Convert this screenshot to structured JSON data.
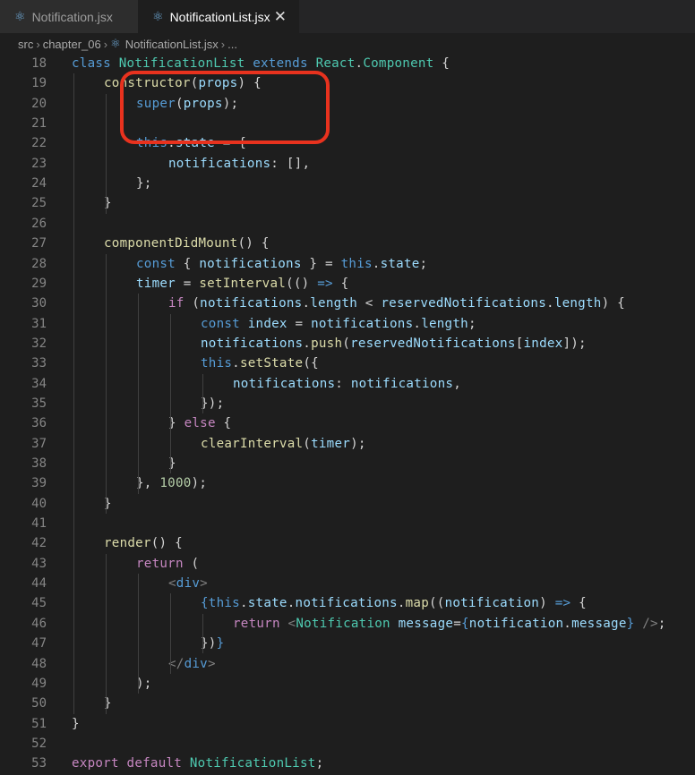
{
  "tabs": [
    {
      "label": "Notification.jsx",
      "active": false,
      "icon": "react-icon"
    },
    {
      "label": "NotificationList.jsx",
      "active": true,
      "icon": "react-icon"
    }
  ],
  "breadcrumb": {
    "items": [
      "src",
      "chapter_06",
      "NotificationList.jsx",
      "..."
    ]
  },
  "highlight": {
    "color": "#e8321e",
    "lines": [
      22,
      23,
      24
    ]
  },
  "code_lines": [
    {
      "n": 18,
      "indent": 0,
      "tokens": [
        [
          "kw",
          "class "
        ],
        [
          "cls",
          "NotificationList "
        ],
        [
          "kw",
          "extends "
        ],
        [
          "cls",
          "React"
        ],
        [
          "pun",
          "."
        ],
        [
          "cls",
          "Component"
        ],
        [
          "pun",
          " {"
        ]
      ]
    },
    {
      "n": 19,
      "indent": 1,
      "tokens": [
        [
          "fn",
          "constructor"
        ],
        [
          "pun",
          "("
        ],
        [
          "var",
          "props"
        ],
        [
          "pun",
          ") {"
        ]
      ]
    },
    {
      "n": 20,
      "indent": 2,
      "tokens": [
        [
          "kw",
          "super"
        ],
        [
          "pun",
          "("
        ],
        [
          "var",
          "props"
        ],
        [
          "pun",
          ");"
        ]
      ]
    },
    {
      "n": 21,
      "indent": 0,
      "tokens": []
    },
    {
      "n": 22,
      "indent": 2,
      "tokens": [
        [
          "kw",
          "this"
        ],
        [
          "pun",
          "."
        ],
        [
          "var",
          "state"
        ],
        [
          "pun",
          " = {"
        ]
      ]
    },
    {
      "n": 23,
      "indent": 3,
      "tokens": [
        [
          "var",
          "notifications"
        ],
        [
          "pun",
          ": [],"
        ]
      ]
    },
    {
      "n": 24,
      "indent": 2,
      "tokens": [
        [
          "pun",
          "};"
        ]
      ]
    },
    {
      "n": 25,
      "indent": 1,
      "tokens": [
        [
          "pun",
          "}"
        ]
      ]
    },
    {
      "n": 26,
      "indent": 0,
      "tokens": []
    },
    {
      "n": 27,
      "indent": 1,
      "tokens": [
        [
          "fn",
          "componentDidMount"
        ],
        [
          "pun",
          "() {"
        ]
      ]
    },
    {
      "n": 28,
      "indent": 2,
      "tokens": [
        [
          "kw",
          "const "
        ],
        [
          "pun",
          "{ "
        ],
        [
          "var",
          "notifications"
        ],
        [
          "pun",
          " } = "
        ],
        [
          "kw",
          "this"
        ],
        [
          "pun",
          "."
        ],
        [
          "var",
          "state"
        ],
        [
          "pun",
          ";"
        ]
      ]
    },
    {
      "n": 29,
      "indent": 2,
      "tokens": [
        [
          "var",
          "timer"
        ],
        [
          "pun",
          " = "
        ],
        [
          "fn",
          "setInterval"
        ],
        [
          "pun",
          "(() "
        ],
        [
          "kw",
          "=>"
        ],
        [
          "pun",
          " {"
        ]
      ]
    },
    {
      "n": 30,
      "indent": 3,
      "tokens": [
        [
          "ctrl",
          "if "
        ],
        [
          "pun",
          "("
        ],
        [
          "var",
          "notifications"
        ],
        [
          "pun",
          "."
        ],
        [
          "var",
          "length"
        ],
        [
          "pun",
          " < "
        ],
        [
          "var",
          "reservedNotifications"
        ],
        [
          "pun",
          "."
        ],
        [
          "var",
          "length"
        ],
        [
          "pun",
          ") {"
        ]
      ]
    },
    {
      "n": 31,
      "indent": 4,
      "tokens": [
        [
          "kw",
          "const "
        ],
        [
          "var",
          "index"
        ],
        [
          "pun",
          " = "
        ],
        [
          "var",
          "notifications"
        ],
        [
          "pun",
          "."
        ],
        [
          "var",
          "length"
        ],
        [
          "pun",
          ";"
        ]
      ]
    },
    {
      "n": 32,
      "indent": 4,
      "tokens": [
        [
          "var",
          "notifications"
        ],
        [
          "pun",
          "."
        ],
        [
          "fn",
          "push"
        ],
        [
          "pun",
          "("
        ],
        [
          "var",
          "reservedNotifications"
        ],
        [
          "pun",
          "["
        ],
        [
          "var",
          "index"
        ],
        [
          "pun",
          "]);"
        ]
      ]
    },
    {
      "n": 33,
      "indent": 4,
      "tokens": [
        [
          "kw",
          "this"
        ],
        [
          "pun",
          "."
        ],
        [
          "fn",
          "setState"
        ],
        [
          "pun",
          "({"
        ]
      ]
    },
    {
      "n": 34,
      "indent": 5,
      "tokens": [
        [
          "var",
          "notifications"
        ],
        [
          "pun",
          ": "
        ],
        [
          "var",
          "notifications"
        ],
        [
          "pun",
          ","
        ]
      ]
    },
    {
      "n": 35,
      "indent": 4,
      "tokens": [
        [
          "pun",
          "});"
        ]
      ]
    },
    {
      "n": 36,
      "indent": 3,
      "tokens": [
        [
          "pun",
          "} "
        ],
        [
          "ctrl",
          "else"
        ],
        [
          "pun",
          " {"
        ]
      ]
    },
    {
      "n": 37,
      "indent": 4,
      "tokens": [
        [
          "fn",
          "clearInterval"
        ],
        [
          "pun",
          "("
        ],
        [
          "var",
          "timer"
        ],
        [
          "pun",
          ");"
        ]
      ]
    },
    {
      "n": 38,
      "indent": 3,
      "tokens": [
        [
          "pun",
          "}"
        ]
      ]
    },
    {
      "n": 39,
      "indent": 2,
      "tokens": [
        [
          "pun",
          "}, "
        ],
        [
          "num",
          "1000"
        ],
        [
          "pun",
          ");"
        ]
      ]
    },
    {
      "n": 40,
      "indent": 1,
      "tokens": [
        [
          "pun",
          "}"
        ]
      ]
    },
    {
      "n": 41,
      "indent": 0,
      "tokens": []
    },
    {
      "n": 42,
      "indent": 1,
      "tokens": [
        [
          "fn",
          "render"
        ],
        [
          "pun",
          "() {"
        ]
      ]
    },
    {
      "n": 43,
      "indent": 2,
      "tokens": [
        [
          "ctrl",
          "return"
        ],
        [
          "pun",
          " ("
        ]
      ]
    },
    {
      "n": 44,
      "indent": 3,
      "tokens": [
        [
          "tag",
          "<"
        ],
        [
          "tname",
          "div"
        ],
        [
          "tag",
          ">"
        ]
      ]
    },
    {
      "n": 45,
      "indent": 4,
      "tokens": [
        [
          "kw",
          "{"
        ],
        [
          "kw",
          "this"
        ],
        [
          "pun",
          "."
        ],
        [
          "var",
          "state"
        ],
        [
          "pun",
          "."
        ],
        [
          "var",
          "notifications"
        ],
        [
          "pun",
          "."
        ],
        [
          "fn",
          "map"
        ],
        [
          "pun",
          "(("
        ],
        [
          "var",
          "notification"
        ],
        [
          "pun",
          ") "
        ],
        [
          "kw",
          "=>"
        ],
        [
          "pun",
          " {"
        ]
      ]
    },
    {
      "n": 46,
      "indent": 5,
      "tokens": [
        [
          "ctrl",
          "return "
        ],
        [
          "tag",
          "<"
        ],
        [
          "cls",
          "Notification "
        ],
        [
          "var",
          "message"
        ],
        [
          "pun",
          "="
        ],
        [
          "kw",
          "{"
        ],
        [
          "var",
          "notification"
        ],
        [
          "pun",
          "."
        ],
        [
          "var",
          "message"
        ],
        [
          "kw",
          "}"
        ],
        [
          "tag",
          " />"
        ],
        [
          "pun",
          ";"
        ]
      ]
    },
    {
      "n": 47,
      "indent": 4,
      "tokens": [
        [
          "pun",
          "})"
        ],
        [
          "kw",
          "}"
        ]
      ]
    },
    {
      "n": 48,
      "indent": 3,
      "tokens": [
        [
          "tag",
          "</"
        ],
        [
          "tname",
          "div"
        ],
        [
          "tag",
          ">"
        ]
      ]
    },
    {
      "n": 49,
      "indent": 2,
      "tokens": [
        [
          "pun",
          ");"
        ]
      ]
    },
    {
      "n": 50,
      "indent": 1,
      "tokens": [
        [
          "pun",
          "}"
        ]
      ]
    },
    {
      "n": 51,
      "indent": 0,
      "tokens": [
        [
          "pun",
          "}"
        ]
      ]
    },
    {
      "n": 52,
      "indent": 0,
      "tokens": []
    },
    {
      "n": 53,
      "indent": 0,
      "tokens": [
        [
          "ctrl",
          "export "
        ],
        [
          "ctrl",
          "default "
        ],
        [
          "cls",
          "NotificationList"
        ],
        [
          "pun",
          ";"
        ]
      ]
    }
  ]
}
